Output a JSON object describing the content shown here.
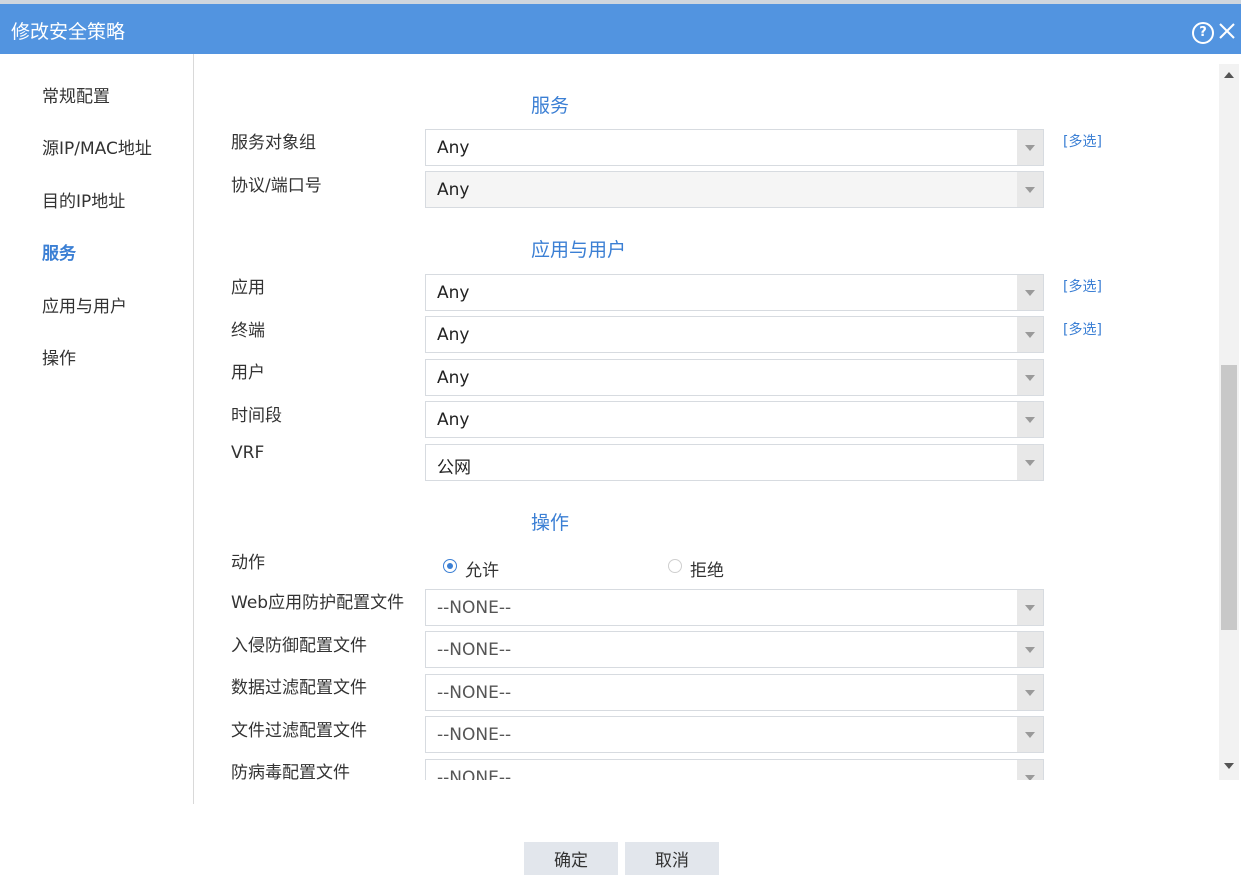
{
  "dialog": {
    "title": "修改安全策略",
    "help_icon": "help-icon",
    "close_icon": "close-icon"
  },
  "sidebar": {
    "items": [
      {
        "label": "常规配置",
        "active": false
      },
      {
        "label": "源IP/MAC地址",
        "active": false
      },
      {
        "label": "目的IP地址",
        "active": false
      },
      {
        "label": "服务",
        "active": true
      },
      {
        "label": "应用与用户",
        "active": false
      },
      {
        "label": "操作",
        "active": false
      }
    ]
  },
  "sections": {
    "service": {
      "title": "服务",
      "service_group": {
        "label": "服务对象组",
        "value": "Any",
        "multi": "[多选]"
      },
      "protocol_port": {
        "label": "协议/端口号",
        "value": "Any"
      }
    },
    "app_user": {
      "title": "应用与用户",
      "application": {
        "label": "应用",
        "value": "Any",
        "multi": "[多选]"
      },
      "terminal": {
        "label": "终端",
        "value": "Any",
        "multi": "[多选]"
      },
      "user": {
        "label": "用户",
        "value": "Any"
      },
      "time_range": {
        "label": "时间段",
        "value": "Any"
      },
      "vrf": {
        "label": "VRF",
        "value": "公网"
      }
    },
    "operation": {
      "title": "操作",
      "action": {
        "label": "动作",
        "allow": "允许",
        "deny": "拒绝",
        "selected": "允许"
      },
      "waf_profile": {
        "label": "Web应用防护配置文件",
        "value": "--NONE--"
      },
      "ips_profile": {
        "label": "入侵防御配置文件",
        "value": "--NONE--"
      },
      "data_filter_profile": {
        "label": "数据过滤配置文件",
        "value": "--NONE--"
      },
      "file_filter_profile": {
        "label": "文件过滤配置文件",
        "value": "--NONE--"
      },
      "antivirus_profile": {
        "label": "防病毒配置文件",
        "value": "--NONE--"
      }
    }
  },
  "buttons": {
    "ok": "确定",
    "cancel": "取消"
  },
  "colors": {
    "titlebar": "#5294e0",
    "accent": "#3b7fd4"
  }
}
